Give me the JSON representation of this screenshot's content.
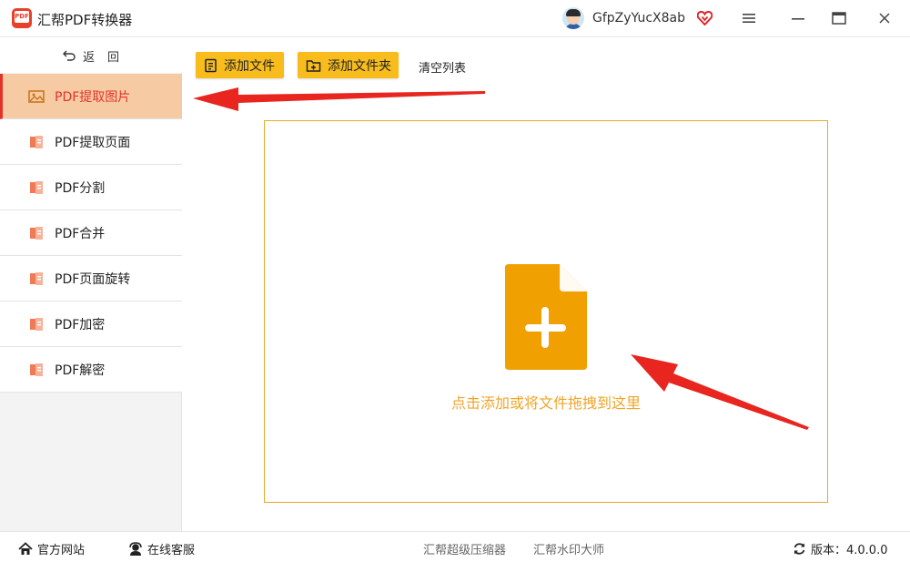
{
  "app": {
    "title": "汇帮PDF转换器",
    "logo_text": "PDF"
  },
  "user": {
    "name": "GfpZyYucX8ab"
  },
  "icons": {
    "vip": "heart-diamond-icon",
    "menu": "hamburger-menu-icon",
    "minimize": "minimize-icon",
    "maximize": "maximize-icon",
    "close": "close-icon"
  },
  "sidebar": {
    "back_label": "返回",
    "items": [
      {
        "label": "PDF提取图片",
        "icon": "image-icon",
        "active": true
      },
      {
        "label": "PDF提取页面",
        "icon": "pdf-file-icon",
        "active": false
      },
      {
        "label": "PDF分割",
        "icon": "pdf-file-icon",
        "active": false
      },
      {
        "label": "PDF合并",
        "icon": "pdf-file-icon",
        "active": false
      },
      {
        "label": "PDF页面旋转",
        "icon": "pdf-file-icon",
        "active": false
      },
      {
        "label": "PDF加密",
        "icon": "pdf-file-icon",
        "active": false
      },
      {
        "label": "PDF解密",
        "icon": "pdf-file-icon",
        "active": false
      }
    ]
  },
  "toolbar": {
    "add_file": "添加文件",
    "add_folder": "添加文件夹",
    "clear_list": "清空列表"
  },
  "dropzone": {
    "hint": "点击添加或将文件拖拽到这里"
  },
  "statusbar": {
    "website": "官方网站",
    "service": "在线客服",
    "compressor": "汇帮超级压缩器",
    "watermark": "汇帮水印大师",
    "version": "版本：4.0.0.0"
  },
  "colors": {
    "accent": "#f8bd1d",
    "active_bg": "#f6cba4",
    "active_text": "#e2332a",
    "drop_border": "#e4a92d",
    "doc_icon": "#f0a000",
    "arrow": "#e8251f"
  }
}
